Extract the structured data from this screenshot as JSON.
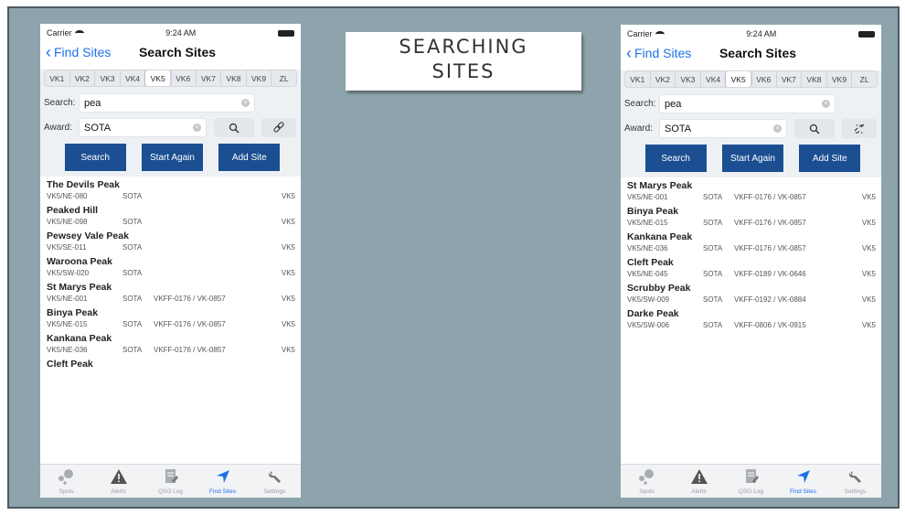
{
  "caption": {
    "line1": "SEARCHING",
    "line2": "SITES"
  },
  "phones": [
    {
      "status": {
        "carrier": "Carrier",
        "time": "9:24 AM"
      },
      "nav": {
        "back": "Find Sites",
        "title": "Search Sites"
      },
      "regions": [
        "VK1",
        "VK2",
        "VK3",
        "VK4",
        "VK5",
        "VK6",
        "VK7",
        "VK8",
        "VK9",
        "ZL"
      ],
      "active_region": "VK5",
      "search": {
        "label": "Search:",
        "value": "pea"
      },
      "award": {
        "label": "Award:",
        "value": "SOTA"
      },
      "link_icon": "link-icon",
      "buttons": {
        "search": "Search",
        "start_again": "Start Again",
        "add_site": "Add Site"
      },
      "results": [
        {
          "name": "The Devils Peak",
          "ref": "VK5/NE-080",
          "program": "SOTA",
          "wwff": "",
          "entity": "VK5"
        },
        {
          "name": "Peaked Hill",
          "ref": "VK5/NE-098",
          "program": "SOTA",
          "wwff": "",
          "entity": "VK5"
        },
        {
          "name": "Pewsey Vale Peak",
          "ref": "VK5/SE-011",
          "program": "SOTA",
          "wwff": "",
          "entity": "VK5"
        },
        {
          "name": "Waroona Peak",
          "ref": "VK5/SW-020",
          "program": "SOTA",
          "wwff": "",
          "entity": "VK5"
        },
        {
          "name": "St Marys Peak",
          "ref": "VK5/NE-001",
          "program": "SOTA",
          "wwff": "VKFF-0176 / VK-0857",
          "entity": "VK5"
        },
        {
          "name": "Binya Peak",
          "ref": "VK5/NE-015",
          "program": "SOTA",
          "wwff": "VKFF-0176 / VK-0857",
          "entity": "VK5"
        },
        {
          "name": "Kankana Peak",
          "ref": "VK5/NE-036",
          "program": "SOTA",
          "wwff": "VKFF-0176 / VK-0857",
          "entity": "VK5"
        },
        {
          "name": "Cleft Peak",
          "ref": "",
          "program": "",
          "wwff": "",
          "entity": ""
        }
      ],
      "tabs": [
        "Spots",
        "Alerts",
        "QSO Log",
        "Find Sites",
        "Settings"
      ],
      "active_tab": "Find Sites"
    },
    {
      "status": {
        "carrier": "Carrier",
        "time": "9:24 AM"
      },
      "nav": {
        "back": "Find Sites",
        "title": "Search Sites"
      },
      "regions": [
        "VK1",
        "VK2",
        "VK3",
        "VK4",
        "VK5",
        "VK6",
        "VK7",
        "VK8",
        "VK9",
        "ZL"
      ],
      "active_region": "VK5",
      "search": {
        "label": "Search:",
        "value": "pea"
      },
      "award": {
        "label": "Award:",
        "value": "SOTA"
      },
      "link_icon": "broken-link-icon",
      "buttons": {
        "search": "Search",
        "start_again": "Start Again",
        "add_site": "Add Site"
      },
      "results": [
        {
          "name": "St Marys Peak",
          "ref": "VK5/NE-001",
          "program": "SOTA",
          "wwff": "VKFF-0176 / VK-0857",
          "entity": "VK5"
        },
        {
          "name": "Binya Peak",
          "ref": "VK5/NE-015",
          "program": "SOTA",
          "wwff": "VKFF-0176 / VK-0857",
          "entity": "VK5"
        },
        {
          "name": "Kankana Peak",
          "ref": "VK5/NE-036",
          "program": "SOTA",
          "wwff": "VKFF-0176 / VK-0857",
          "entity": "VK5"
        },
        {
          "name": "Cleft Peak",
          "ref": "VK5/NE-045",
          "program": "SOTA",
          "wwff": "VKFF-0189 / VK-0646",
          "entity": "VK5"
        },
        {
          "name": "Scrubby Peak",
          "ref": "VK5/SW-009",
          "program": "SOTA",
          "wwff": "VKFF-0192 / VK-0884",
          "entity": "VK5"
        },
        {
          "name": "Darke Peak",
          "ref": "VK5/SW-006",
          "program": "SOTA",
          "wwff": "VKFF-0806 / VK-0915",
          "entity": "VK5"
        }
      ],
      "tabs": [
        "Spots",
        "Alerts",
        "QSO Log",
        "Find Sites",
        "Settings"
      ],
      "active_tab": "Find Sites"
    }
  ],
  "colors": {
    "background": "#8da4ad",
    "accent": "#1e70e8",
    "button": "#1b4f92"
  }
}
